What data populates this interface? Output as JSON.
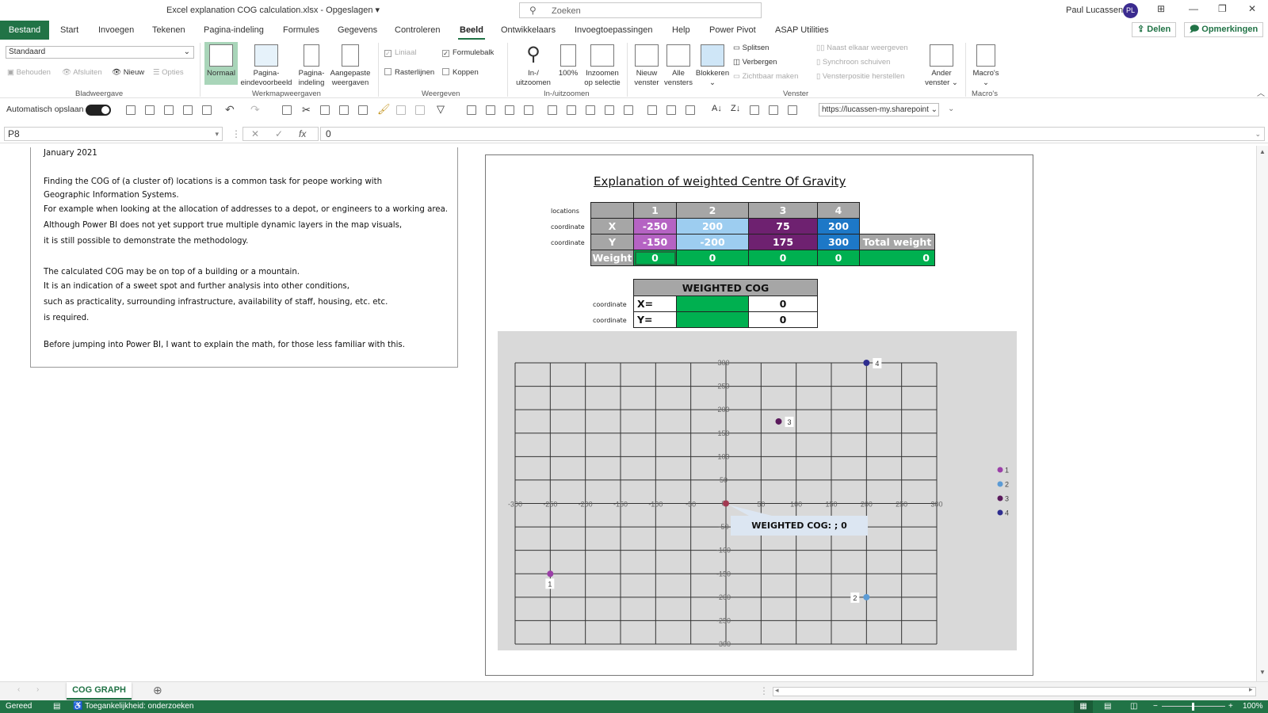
{
  "titlebar": {
    "document": "Excel explanation COG calculation.xlsx",
    "save_status": "Opgeslagen",
    "search_placeholder": "Zoeken",
    "user_name": "Paul Lucassen",
    "user_initials": "PL"
  },
  "tabs": [
    "Bestand",
    "Start",
    "Invoegen",
    "Tekenen",
    "Pagina-indeling",
    "Formules",
    "Gegevens",
    "Controleren",
    "Beeld",
    "Ontwikkelaars",
    "Invoegtoepassingen",
    "Help",
    "Power Pivot",
    "ASAP Utilities"
  ],
  "active_tab": "Beeld",
  "share": {
    "delen": "Delen",
    "opmerkingen": "Opmerkingen"
  },
  "ribbon": {
    "bladweergave": {
      "select_value": "Standaard",
      "behouden": "Behouden",
      "afsluiten": "Afsluiten",
      "nieuw": "Nieuw",
      "opties": "Opties",
      "label": "Bladweergave"
    },
    "werkmap": {
      "normaal": "Normaal",
      "pagina_eind_1": "Pagina-",
      "pagina_eind_2": "eindevoorbeeld",
      "pagina_ind_1": "Pagina-",
      "pagina_ind_2": "indeling",
      "aangepast_1": "Aangepaste",
      "aangepast_2": "weergaven",
      "label": "Werkmapweergaven"
    },
    "weergeven": {
      "liniaal": "Liniaal",
      "formulebalk": "Formulebalk",
      "rasterlijnen": "Rasterlijnen",
      "koppen": "Koppen",
      "label": "Weergeven",
      "liniaal_checked": true,
      "formulebalk_checked": true,
      "rasterlijnen_checked": false,
      "koppen_checked": false
    },
    "zoom": {
      "inuit_1": "In-/",
      "inuit_2": "uitzoomen",
      "pct": "100%",
      "sel_1": "Inzoomen",
      "sel_2": "op selectie",
      "label": "In-/uitzoomen"
    },
    "venster": {
      "nieuw_1": "Nieuw",
      "nieuw_2": "venster",
      "alle_1": "Alle",
      "alle_2": "vensters",
      "blokkeren": "Blokkeren",
      "splitsen": "Splitsen",
      "verbergen": "Verbergen",
      "zichtbaar": "Zichtbaar maken",
      "naast": "Naast elkaar weergeven",
      "synchroon": "Synchroon schuiven",
      "positie": "Vensterpositie herstellen",
      "ander_1": "Ander",
      "ander_2": "venster",
      "label": "Venster"
    },
    "macros": {
      "btn": "Macro's",
      "label": "Macro's"
    }
  },
  "qat": {
    "autosave_label": "Automatisch opslaan",
    "autosave_on": true,
    "url": "https://lucassen-my.sharepoint"
  },
  "formula_bar": {
    "namebox": "P8",
    "formula": "0",
    "fx": "fx"
  },
  "textbox": {
    "lines": [
      "January 2021",
      "Finding the COG of (a cluster of) locations is a common task for peope working with",
      "Geographic Information Systems.",
      "For example when looking at the allocation of addresses to a depot, or engineers to a working area.",
      "Although Power BI does not yet support true multiple dynamic layers in the map visuals,",
      "it is still possible to demonstrate the methodology.",
      "The calculated COG may be on top of a building or a mountain.",
      "It is an indication of a sweet spot and further analysis into other conditions,",
      "such as practicality, surrounding infrastructure, availability of staff, housing, etc. etc.",
      "is required.",
      "Before jumping into Power BI, I want to explain the math, for those less familiar with this."
    ]
  },
  "cog": {
    "title": "Explanation of weighted Centre Of Gravity",
    "row_labels": {
      "locations": "locations",
      "coord_x": "coordinate",
      "coord_y": "coordinate"
    },
    "headers": [
      "1",
      "2",
      "3",
      "4"
    ],
    "x_label": "X",
    "y_label": "Y",
    "weight_label": "Weight",
    "x": [
      "-250",
      "200",
      "75",
      "200"
    ],
    "y": [
      "-150",
      "-200",
      "175",
      "300"
    ],
    "weight": [
      "0",
      "0",
      "0",
      "0"
    ],
    "total_weight_label": "Total weight",
    "total_weight": "0",
    "weighted": {
      "title": "WEIGHTED COG",
      "x_label": "X=",
      "y_label": "Y=",
      "x_value": "0",
      "y_value": "0",
      "row_label": "coordinate"
    }
  },
  "chart_data": {
    "type": "scatter",
    "title": "",
    "xlabel": "",
    "ylabel": "",
    "xlim": [
      -300,
      300
    ],
    "ylim": [
      -300,
      300
    ],
    "xticks": [
      -300,
      -250,
      -200,
      -150,
      -100,
      -50,
      0,
      50,
      100,
      150,
      200,
      250,
      300
    ],
    "yticks": [
      -300,
      -250,
      -200,
      -150,
      -100,
      -50,
      0,
      50,
      100,
      150,
      200,
      250,
      300
    ],
    "grid": true,
    "legend": "right",
    "series": [
      {
        "name": "1",
        "x": -250,
        "y": -150,
        "color": "#9b3fa8"
      },
      {
        "name": "2",
        "x": 200,
        "y": -200,
        "color": "#5b9bd5"
      },
      {
        "name": "3",
        "x": 75,
        "y": 175,
        "color": "#5a1a5c"
      },
      {
        "name": "4",
        "x": 200,
        "y": 300,
        "color": "#2e2d8f"
      }
    ],
    "cog_point": {
      "x": 0,
      "y": 0,
      "color": "#a33a52"
    },
    "annotation": "WEIGHTED COG:  ; 0"
  },
  "sheet_tab": "COG GRAPH",
  "status": {
    "ready": "Gereed",
    "accessibility": "Toegankelijkheid: onderzoeken",
    "zoom": "100%"
  }
}
